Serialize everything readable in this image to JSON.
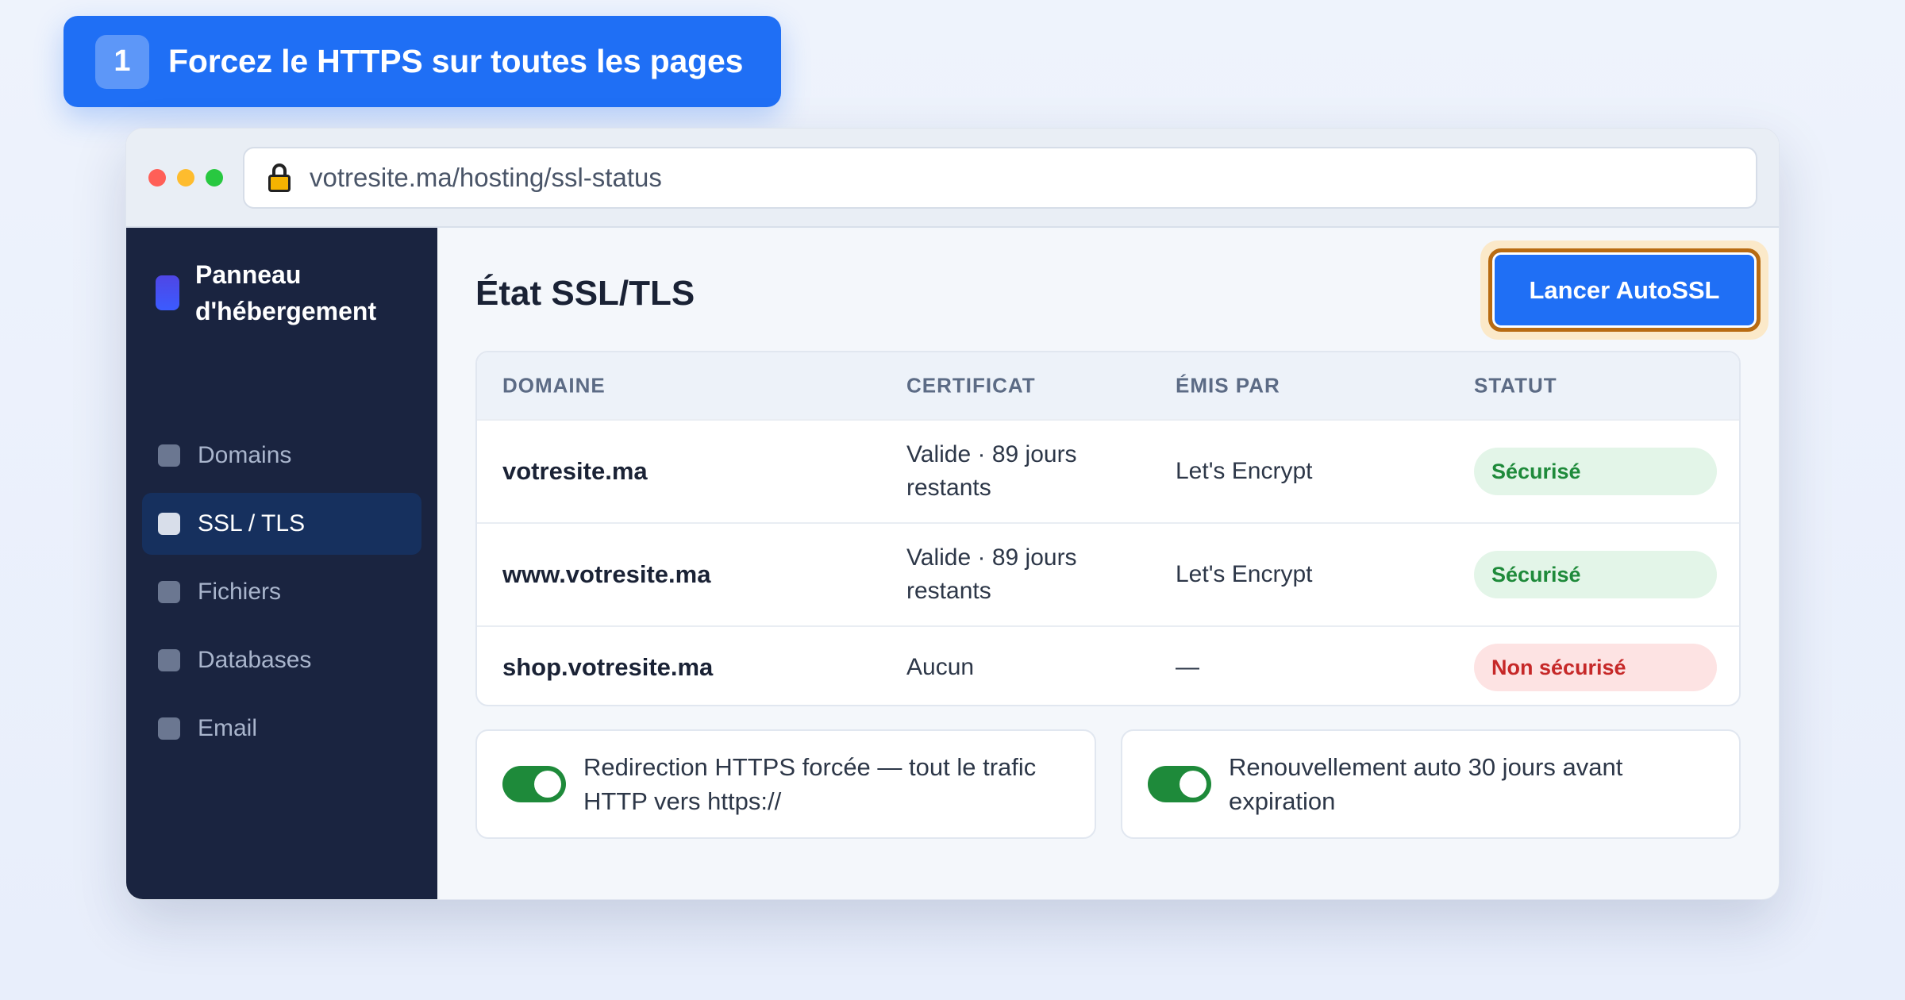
{
  "step": {
    "number": "1",
    "title": "Forcez le HTTPS sur toutes les pages"
  },
  "browser": {
    "url": "votresite.ma/hosting/ssl-status"
  },
  "sidebar": {
    "brand": "Panneau d'hébergement",
    "items": [
      {
        "label": "Domains",
        "active": false
      },
      {
        "label": "SSL / TLS",
        "active": true
      },
      {
        "label": "Fichiers",
        "active": false
      },
      {
        "label": "Databases",
        "active": false
      },
      {
        "label": "Email",
        "active": false
      }
    ]
  },
  "main": {
    "title": "État SSL/TLS",
    "autossl_label": "Lancer AutoSSL",
    "table": {
      "headers": [
        "DOMAINE",
        "CERTIFICAT",
        "ÉMIS PAR",
        "STATUT"
      ],
      "rows": [
        {
          "domain": "votresite.ma",
          "certificate": "Valide · 89 jours restants",
          "issuer": "Let's Encrypt",
          "status": "Sécurisé"
        },
        {
          "domain": "www.votresite.ma",
          "certificate": "Valide · 89 jours restants",
          "issuer": "Let's Encrypt",
          "status": "Sécurisé"
        },
        {
          "domain": "shop.votresite.ma",
          "certificate": "Aucun",
          "issuer": "—",
          "status": "Non sécurisé"
        }
      ]
    },
    "toggles": [
      {
        "label": "Redirection HTTPS forcée — tout le trafic HTTP vers https://",
        "on": true
      },
      {
        "label": "Renouvellement auto 30 jours avant expiration",
        "on": true
      }
    ]
  },
  "colors": {
    "accent": "#1f6ff5",
    "sidebar": "#1a2440",
    "success": "#1e8a3a",
    "danger": "#c62828",
    "highlight": "#b86b12"
  }
}
